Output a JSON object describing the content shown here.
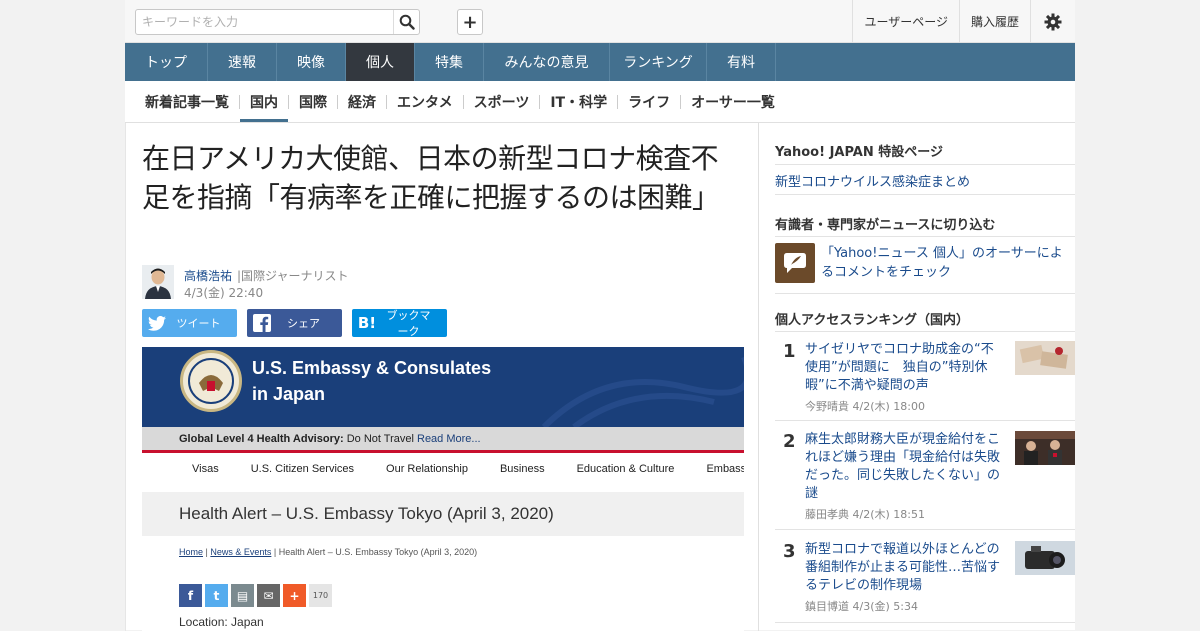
{
  "search": {
    "placeholder": "キーワードを入力"
  },
  "top_links": {
    "user_page": "ユーザーページ",
    "purchase_history": "購入履歴"
  },
  "main_nav": [
    "トップ",
    "速報",
    "映像",
    "個人",
    "特集",
    "みんなの意見",
    "ランキング",
    "有料"
  ],
  "main_nav_active": "個人",
  "sub_nav": [
    "新着記事一覧",
    "国内",
    "国際",
    "経済",
    "エンタメ",
    "スポーツ",
    "IT・科学",
    "ライフ",
    "オーサー一覧"
  ],
  "sub_nav_active": "国内",
  "article": {
    "headline": "在日アメリカ大使館、日本の新型コロナ検査不足を指摘「有病率を正確に把握するのは困難」",
    "author_name": "高橋浩祐",
    "author_title": "|国際ジャーナリスト",
    "date": "4/3(金) 22:40",
    "share_twitter": "ツイート",
    "share_facebook": "シェア",
    "share_hatena": "ブックマーク"
  },
  "embed": {
    "site_title_1": "U.S. Embassy & Consulates",
    "site_title_2": "in Japan",
    "advisory_label": "Global Level 4 Health Advisory:",
    "advisory_text": " Do Not Travel ",
    "advisory_more": "Read More...",
    "nav": [
      "Visas",
      "U.S. Citizen Services",
      "Our Relationship",
      "Business",
      "Education & Culture",
      "Embassy & Co"
    ],
    "alert_title": "Health Alert – U.S. Embassy Tokyo (April 3, 2020)",
    "crumb_home": "Home",
    "crumb_news": "News & Events",
    "crumb_current": " | Health Alert – U.S. Embassy Tokyo (April 3, 2020)",
    "share_count": "170",
    "location": "Location: Japan"
  },
  "sidebar": {
    "special_head": "Yahoo! JAPAN 特設ページ",
    "special_link": "新型コロナウイルス感染症まとめ",
    "experts_head": "有識者・専門家がニュースに切り込む",
    "experts_link": "「Yahoo!ニュース 個人」のオーサーによるコメントをチェック",
    "ranking_head": "個人アクセスランキング（国内）",
    "ranking": [
      {
        "num": "1",
        "title": "サイゼリヤでコロナ助成金の“不使用”が問題に　独自の”特別休暇”に不満や疑問の声",
        "meta": "今野晴貴  4/2(木) 18:00"
      },
      {
        "num": "2",
        "title": "麻生太郎財務大臣が現金給付をこれほど嫌う理由「現金給付は失敗だった。同じ失敗したくない」の謎",
        "meta": "藤田孝典  4/2(木) 18:51"
      },
      {
        "num": "3",
        "title": "新型コロナで報道以外ほとんどの番組制作が止まる可能性…苦悩するテレビの制作現場",
        "meta": "鎮目博道  4/3(金) 5:34"
      }
    ]
  },
  "colors": {
    "nav_bg": "#43708f",
    "nav_active": "#33383f",
    "link": "#1a4b8c",
    "embassy_blue": "#1a3f7a"
  }
}
